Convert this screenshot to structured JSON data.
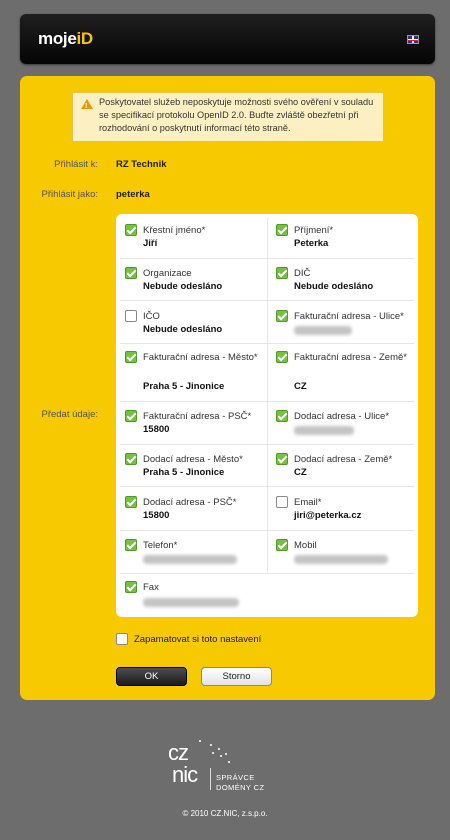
{
  "header": {
    "logo_text": "moje",
    "logo_id": "iD",
    "language_flag": "uk-flag-icon"
  },
  "warning": {
    "text": "Poskytovatel služeb neposkytuje možnosti svého ověření v souladu se specifikací protokolu OpenID 2.0. Buďte zvláště obezřetní při rozhodování o poskytnutí informací této straně."
  },
  "login": {
    "to_label": "Přihlásit k:",
    "to_value": "RZ Technik",
    "as_label": "Přihlásit jako:",
    "as_value": "peterka",
    "share_label": "Předat údaje:"
  },
  "fields": [
    {
      "label": "Křestní jméno*",
      "value": "Jiří",
      "checked": true
    },
    {
      "label": "Příjmení*",
      "value": "Peterka",
      "checked": true
    },
    {
      "label": "Organizace",
      "value": "Nebude odesláno",
      "checked": true
    },
    {
      "label": "DIČ",
      "value": "Nebude odesláno",
      "checked": true
    },
    {
      "label": "IČO",
      "value": "Nebude odesláno",
      "checked": false
    },
    {
      "label": "Fakturační adresa - Ulice*",
      "value": "",
      "checked": true
    },
    {
      "label": "Fakturační adresa - Město*",
      "value": "Praha 5 - Jinonice",
      "checked": true
    },
    {
      "label": "Fakturační adresa - Země*",
      "value": "CZ",
      "checked": true
    },
    {
      "label": "Fakturační adresa - PSČ*",
      "value": "15800",
      "checked": true
    },
    {
      "label": "Dodací adresa - Ulice*",
      "value": "",
      "checked": true
    },
    {
      "label": "Dodací adresa - Město*",
      "value": "Praha 5 - Jinonice",
      "checked": true
    },
    {
      "label": "Dodací adresa - Země*",
      "value": "CZ",
      "checked": true
    },
    {
      "label": "Dodací adresa - PSČ*",
      "value": "15800",
      "checked": true
    },
    {
      "label": "Email*",
      "value": "jiri@peterka.cz",
      "checked": false
    },
    {
      "label": "Telefon*",
      "value": "",
      "checked": true
    },
    {
      "label": "Mobil",
      "value": "",
      "checked": true
    },
    {
      "label": "Fax",
      "value": "",
      "checked": true
    }
  ],
  "remember": {
    "label": "Zapamatovat si toto nastavení",
    "checked": false
  },
  "buttons": {
    "ok": "OK",
    "cancel": "Storno"
  },
  "footer": {
    "cz": "cz",
    "nic": "nic",
    "spravce_line1": "SPRÁVCE",
    "spravce_line2": "DOMÉNY CZ",
    "copyright": "© 2010 CZ.NIC, z.s.p.o."
  }
}
